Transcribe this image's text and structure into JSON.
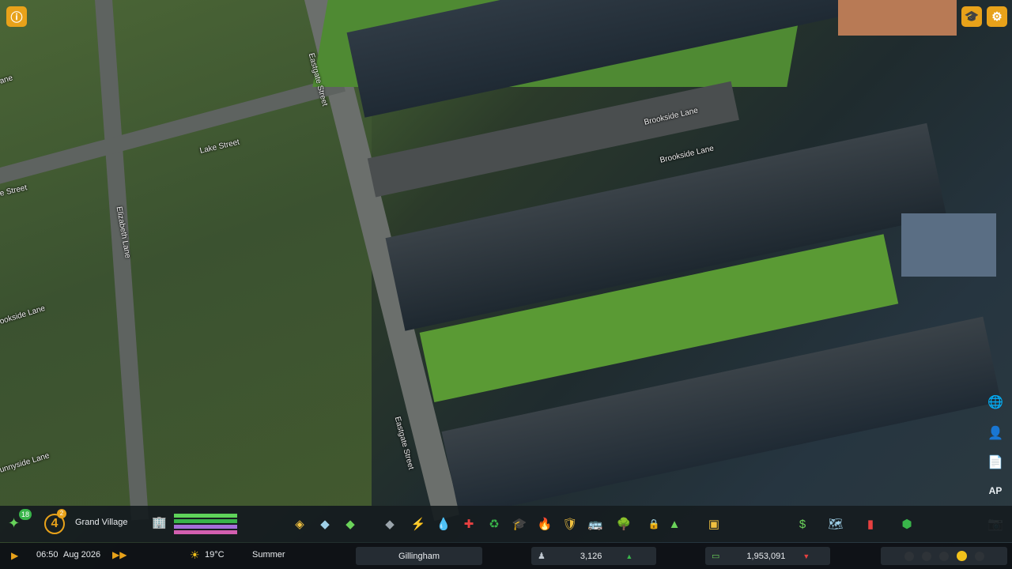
{
  "map": {
    "roads": [
      "Eastgate Street",
      "Brookside Lane",
      "Brookside Lane",
      "Lake Street",
      "e Street",
      "Elizabeth Lane",
      "ookside Lane",
      "Eastgate Street",
      "unnyside Lane",
      "ane"
    ]
  },
  "top_right": {
    "academy_icon": "graduation-cap-icon",
    "settings_icon": "gear-icon"
  },
  "top_left": {
    "info_icon": "info-icon"
  },
  "side_panel": {
    "icons": [
      "globe-icon",
      "person-icon",
      "document-icon",
      "ap-icon",
      "camera-icon"
    ],
    "ap_label": "AP"
  },
  "toolbar": {
    "xp_badge": "18",
    "level_number": "4",
    "level_badge": "2",
    "city_rank": "Grand Village",
    "progress_colors": [
      "#5fd35a",
      "#39b54a",
      "#a56fd9",
      "#d35fb0"
    ],
    "tools": [
      "roads-icon",
      "zoning-icon",
      "areas-icon",
      "landscaping-icon",
      "electricity-icon",
      "water-icon",
      "health-icon",
      "garbage-icon",
      "education-icon",
      "fire-icon",
      "police-icon",
      "transport-icon",
      "parks-icon",
      "lock-icon",
      "signature-icon",
      "unique-buildings-icon"
    ],
    "right_tools": [
      "economy-icon",
      "map-icon",
      "statistics-icon",
      "districts-icon"
    ]
  },
  "status": {
    "time": "06:50",
    "date": "Aug 2026",
    "temperature": "19°C",
    "season": "Summer",
    "city_name": "Gillingham",
    "population": "3,126",
    "money": "1,953,091",
    "accent": "#e8a21a"
  }
}
